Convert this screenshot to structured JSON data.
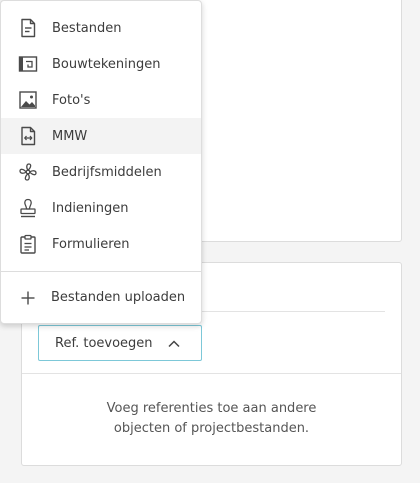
{
  "menu": {
    "items": [
      {
        "label": "Bestanden",
        "icon": "document-icon"
      },
      {
        "label": "Bouwtekeningen",
        "icon": "blueprint-icon"
      },
      {
        "label": "Foto's",
        "icon": "image-icon"
      },
      {
        "label": "MMW",
        "icon": "swap-file-icon"
      },
      {
        "label": "Bedrijfsmiddelen",
        "icon": "fan-icon"
      },
      {
        "label": "Indieningen",
        "icon": "stamp-icon"
      },
      {
        "label": "Formulieren",
        "icon": "clipboard-icon"
      }
    ],
    "upload_label": "Bestanden uploaden",
    "upload_icon": "plus-icon"
  },
  "references": {
    "button_label": "Ref. toevoegen",
    "button_icon": "chevron-up-icon",
    "empty_line1": "Voeg referenties toe aan andere",
    "empty_line2": "objecten of projectbestanden."
  },
  "colors": {
    "accent_border": "#7dc8d8",
    "hover_background": "#f3f3f3"
  }
}
